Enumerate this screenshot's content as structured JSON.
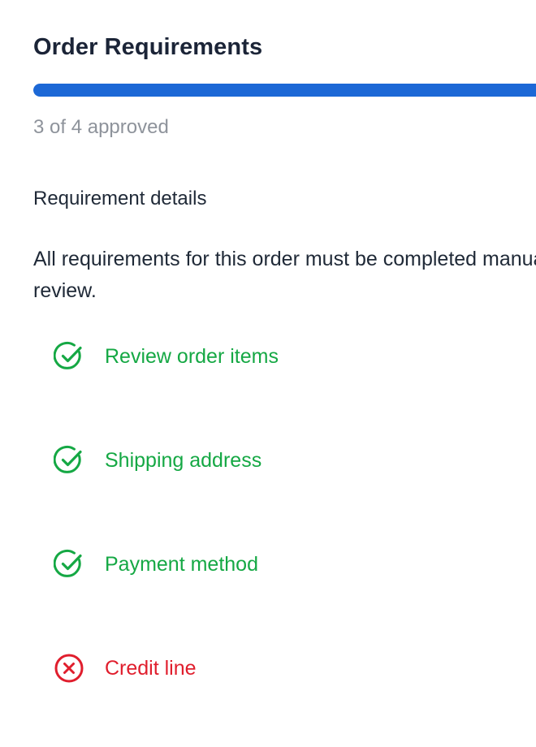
{
  "title": "Order Requirements",
  "progress": {
    "approved": 3,
    "total": 4,
    "fraction": 1.0,
    "text": "3 of 4 approved",
    "color": "#1c68d6"
  },
  "details": {
    "heading": "Requirement details",
    "description": "All requirements for this order must be completed manual review."
  },
  "requirements": [
    {
      "label": "Review order items",
      "status": "approved",
      "icon": "check-circle-icon",
      "color": "#15a844"
    },
    {
      "label": "Shipping address",
      "status": "approved",
      "icon": "check-circle-icon",
      "color": "#15a844"
    },
    {
      "label": "Payment method",
      "status": "approved",
      "icon": "check-circle-icon",
      "color": "#15a844"
    },
    {
      "label": "Credit line",
      "status": "rejected",
      "icon": "x-circle-icon",
      "color": "#e01e2d"
    }
  ]
}
